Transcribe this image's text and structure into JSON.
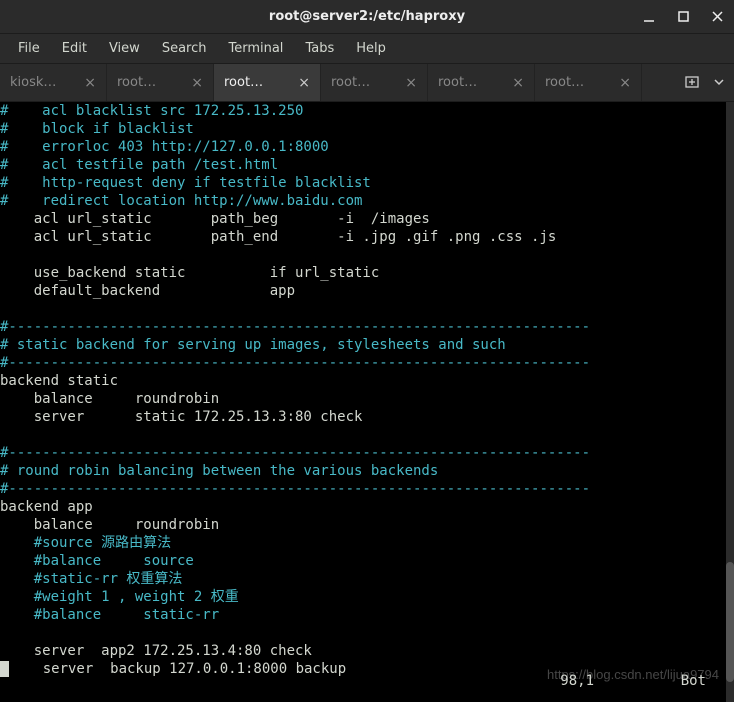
{
  "window": {
    "title": "root@server2:/etc/haproxy"
  },
  "menu": {
    "file": "File",
    "edit": "Edit",
    "view": "View",
    "search": "Search",
    "terminal": "Terminal",
    "tabs": "Tabs",
    "help": "Help"
  },
  "tabs": [
    {
      "label": "kiosk…"
    },
    {
      "label": "root…"
    },
    {
      "label": "root…"
    },
    {
      "label": "root…"
    },
    {
      "label": "root…"
    },
    {
      "label": "root…"
    }
  ],
  "active_tab_index": 2,
  "editor": {
    "lines": [
      {
        "c": "comment",
        "t": "#    acl blacklist src 172.25.13.250"
      },
      {
        "c": "comment",
        "t": "#    block if blacklist"
      },
      {
        "c": "comment",
        "t": "#    errorloc 403 http://127.0.0.1:8000"
      },
      {
        "c": "comment",
        "t": "#    acl testfile path /test.html"
      },
      {
        "c": "comment",
        "t": "#    http-request deny if testfile blacklist"
      },
      {
        "c": "comment",
        "t": "#    redirect location http://www.baidu.com"
      },
      {
        "c": "normal",
        "t": "    acl url_static       path_beg       -i  /images"
      },
      {
        "c": "normal",
        "t": "    acl url_static       path_end       -i .jpg .gif .png .css .js"
      },
      {
        "c": "normal",
        "t": ""
      },
      {
        "c": "normal",
        "t": "    use_backend static          if url_static"
      },
      {
        "c": "normal",
        "t": "    default_backend             app"
      },
      {
        "c": "normal",
        "t": ""
      },
      {
        "c": "comment",
        "t": "#---------------------------------------------------------------------"
      },
      {
        "c": "comment",
        "t": "# static backend for serving up images, stylesheets and such"
      },
      {
        "c": "comment",
        "t": "#---------------------------------------------------------------------"
      },
      {
        "c": "normal",
        "t": "backend static"
      },
      {
        "c": "normal",
        "t": "    balance     roundrobin"
      },
      {
        "c": "normal",
        "t": "    server      static 172.25.13.3:80 check"
      },
      {
        "c": "normal",
        "t": ""
      },
      {
        "c": "comment",
        "t": "#---------------------------------------------------------------------"
      },
      {
        "c": "comment",
        "t": "# round robin balancing between the various backends"
      },
      {
        "c": "comment",
        "t": "#---------------------------------------------------------------------"
      },
      {
        "c": "normal",
        "t": "backend app"
      },
      {
        "c": "normal",
        "t": "    balance     roundrobin"
      },
      {
        "c": "comment",
        "t": "    #source 源路由算法"
      },
      {
        "c": "comment",
        "t": "    #balance     source"
      },
      {
        "c": "comment",
        "t": "    #static-rr 权重算法"
      },
      {
        "c": "comment",
        "t": "    #weight 1 , weight 2 权重"
      },
      {
        "c": "comment",
        "t": "    #balance     static-rr"
      },
      {
        "c": "normal",
        "t": ""
      },
      {
        "c": "normal",
        "t": "    server  app2 172.25.13.4:80 check"
      },
      {
        "c": "normal",
        "t": "    server  backup 127.0.0.1:8000 backup",
        "cursor": true
      }
    ],
    "status_pos": "98,1",
    "status_mode": "Bot"
  },
  "watermark": "https://blog.csdn.net/lijua9794"
}
